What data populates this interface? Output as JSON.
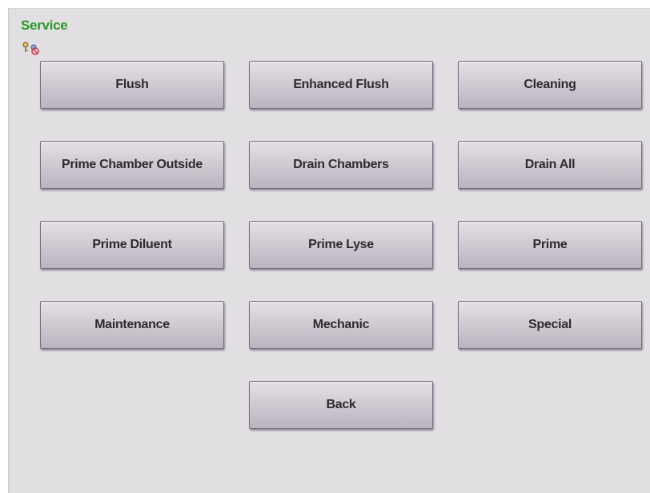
{
  "header": {
    "title": "Service"
  },
  "status_icons": [
    "key-icon",
    "user-badge-icon"
  ],
  "buttons": {
    "flush": "Flush",
    "enhanced_flush": "Enhanced Flush",
    "cleaning": "Cleaning",
    "prime_chamber_outside": "Prime Chamber Outside",
    "drain_chambers": "Drain Chambers",
    "drain_all": "Drain All",
    "prime_diluent": "Prime Diluent",
    "prime_lyse": "Prime Lyse",
    "prime": "Prime",
    "maintenance": "Maintenance",
    "mechanic": "Mechanic",
    "special": "Special",
    "back": "Back"
  },
  "colors": {
    "title": "#2c9a2c",
    "panel_background": "#e1dfe1",
    "button_border": "#7b6b82",
    "button_text": "#2e2a32"
  }
}
